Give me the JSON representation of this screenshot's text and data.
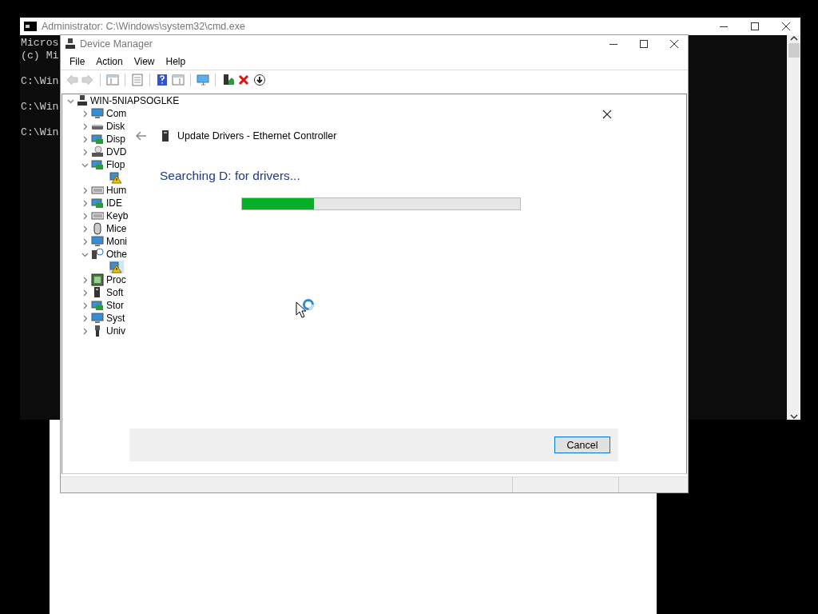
{
  "cmd_window": {
    "title": "Administrator: C:\\Windows\\system32\\cmd.exe",
    "header_lines": [
      "Micros",
      "(c) Mi"
    ],
    "prompts": [
      "C:\\Win",
      "C:\\Win",
      "C:\\Win"
    ]
  },
  "device_manager": {
    "title": "Device Manager",
    "menu": [
      "File",
      "Action",
      "View",
      "Help"
    ],
    "toolbar": [
      {
        "kind": "back",
        "disabled": true
      },
      {
        "kind": "forward",
        "disabled": true
      },
      {
        "kind": "tree",
        "disabled": false
      },
      {
        "kind": "properties",
        "disabled": false
      },
      {
        "kind": "help",
        "disabled": false
      },
      {
        "kind": "pane",
        "disabled": false
      },
      {
        "kind": "scan",
        "disabled": false
      },
      {
        "kind": "update",
        "disabled": false
      },
      {
        "kind": "remove",
        "disabled": false
      },
      {
        "kind": "download",
        "disabled": false
      }
    ],
    "tree": {
      "label": "WIN-5NIAPSOGLKE",
      "expanded": true,
      "children": [
        {
          "label": "Com",
          "kind": "monitor",
          "expanded": false
        },
        {
          "label": "Disk",
          "kind": "disk",
          "expanded": false
        },
        {
          "label": "Disp",
          "kind": "card",
          "expanded": false
        },
        {
          "label": "DVD",
          "kind": "dvd",
          "expanded": false
        },
        {
          "label": "Flop",
          "kind": "card",
          "expanded": true,
          "children": [
            {
              "kind": "warning",
              "selected": false
            }
          ]
        },
        {
          "label": "Hum",
          "kind": "keyboard",
          "expanded": false
        },
        {
          "label": "IDE",
          "kind": "card",
          "expanded": false
        },
        {
          "label": "Keyb",
          "kind": "keyboard",
          "expanded": false
        },
        {
          "label": "Mice",
          "kind": "mouse",
          "expanded": false
        },
        {
          "label": "Moni",
          "kind": "monitor",
          "expanded": false
        },
        {
          "label": "Othe",
          "kind": "unknown",
          "expanded": true,
          "children": [
            {
              "kind": "warning",
              "selected": true
            }
          ]
        },
        {
          "label": "Proc",
          "kind": "chip",
          "expanded": false
        },
        {
          "label": "Soft",
          "kind": "tower",
          "expanded": false
        },
        {
          "label": "Stor",
          "kind": "card",
          "expanded": false
        },
        {
          "label": "Syst",
          "kind": "monitor",
          "expanded": false
        },
        {
          "label": "Univ",
          "kind": "usb",
          "expanded": false
        }
      ]
    }
  },
  "dialog": {
    "title": "Update Drivers - Ethernet Controller",
    "heading": "Searching D: for drivers...",
    "progress": {
      "level": 0.26
    },
    "buttons": [
      "Cancel"
    ]
  }
}
